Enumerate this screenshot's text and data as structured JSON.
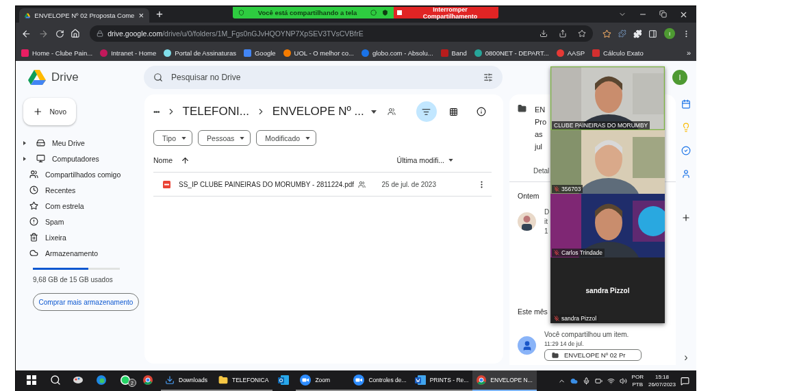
{
  "browser": {
    "tab": {
      "title": "ENVELOPE Nº 02 Proposta Come",
      "close": "×"
    },
    "new_tab": "+",
    "share_banner": {
      "text": "Você está compartilhando a tela",
      "stop": "Interromper Compartilhamento"
    },
    "url": {
      "domain": "drive.google.com",
      "path": "/drive/u/0/folders/1M_Fgs0nGJvHQOYNP7XpSEV3TVsCVBfrE"
    },
    "profile_initial": "I",
    "bookmarks": [
      {
        "label": "Home - Clube Pain...",
        "color": "#e91e63"
      },
      {
        "label": "Intranet - Home",
        "color": "#c2185b"
      },
      {
        "label": "Portal de Assinaturas",
        "color": "#80deea"
      },
      {
        "label": "Google",
        "color": "#4285f4"
      },
      {
        "label": "UOL - O melhor co...",
        "color": "#f57c00"
      },
      {
        "label": "globo.com - Absolu...",
        "color": "#1a73e8"
      },
      {
        "label": "Band",
        "color": "#b71c1c"
      },
      {
        "label": "0800NET - DEPART...",
        "color": "#26a69a"
      },
      {
        "label": "AASP",
        "color": "#e53935"
      },
      {
        "label": "Cálculo Exato",
        "color": "#d32f2f"
      }
    ],
    "bookmarks_more": "»"
  },
  "drive": {
    "logo_text": "Drive",
    "search_placeholder": "Pesquisar no Drive",
    "new_button": "Novo",
    "profile_initial": "I",
    "nav": [
      {
        "label": "Meu Drive",
        "kind": "drive",
        "expandable": true,
        "selected": false
      },
      {
        "label": "Computadores",
        "kind": "computers",
        "expandable": true,
        "selected": false
      },
      {
        "label": "Compartilhados comigo",
        "kind": "shared",
        "expandable": false,
        "selected": false
      },
      {
        "label": "Recentes",
        "kind": "recent",
        "expandable": false,
        "selected": false
      },
      {
        "label": "Com estrela",
        "kind": "starred",
        "expandable": false,
        "selected": false
      },
      {
        "label": "Spam",
        "kind": "spam",
        "expandable": false,
        "selected": false
      },
      {
        "label": "Lixeira",
        "kind": "trash",
        "expandable": false,
        "selected": false
      },
      {
        "label": "Armazenamento",
        "kind": "storage",
        "expandable": false,
        "selected": false
      }
    ],
    "storage": {
      "level": 0.64,
      "text": "9,68 GB de 15 GB usados",
      "button": "Comprar mais armazenamento"
    },
    "breadcrumb": {
      "more": "•••",
      "items": [
        "TELEFONI...",
        "ENVELOPE Nº ..."
      ]
    },
    "filters": [
      "Tipo",
      "Pessoas",
      "Modificado"
    ],
    "filter_panel_open": true,
    "columns": {
      "name": "Nome",
      "modified": "Última modifi..."
    },
    "rows": [
      {
        "name": "SS_IP CLUBE PAINEIRAS DO MORUMBY - 2811224.pdf",
        "shared": true,
        "modified": "25 de jul. de 2023"
      }
    ],
    "details": {
      "title_lines": [
        "EN",
        "Pro",
        "as",
        "jul"
      ],
      "tab": "Detal",
      "sections": [
        {
          "heading": "Ontem",
          "activities": [
            {
              "lines": [
                "D",
                "it",
                "1"
              ]
            }
          ]
        },
        {
          "heading": "Este mês",
          "activities": [
            {
              "kind": "person",
              "text": "Você compartilhou um item.",
              "time": "11:29 14 de jul.",
              "chip": "ENVELOPE Nº 02 Pr"
            }
          ]
        }
      ]
    },
    "side_apps": [
      {
        "kind": "calendar"
      },
      {
        "kind": "keep"
      },
      {
        "kind": "tasks"
      },
      {
        "kind": "contacts"
      },
      {
        "kind": "add"
      }
    ],
    "side_toggle": "›"
  },
  "meeting": {
    "participants": [
      {
        "name": "CLUBE PAINEIRAS DO MORUMBY",
        "video": true,
        "muted": false,
        "speaking": true
      },
      {
        "name": "356703",
        "video": true,
        "muted": true,
        "speaking": false
      },
      {
        "name": "Carlos Trindade",
        "video": true,
        "muted": true,
        "speaking": false
      },
      {
        "name": "sandra Pizzol",
        "center_name": "sandra Pizzol",
        "video": false,
        "muted": true,
        "speaking": false
      }
    ]
  },
  "taskbar": {
    "apps": [
      {
        "kind": "windows"
      },
      {
        "kind": "search"
      },
      {
        "kind": "paint"
      },
      {
        "kind": "edge"
      },
      {
        "kind": "whatsapp",
        "badge": "2"
      },
      {
        "kind": "chrome"
      },
      {
        "kind": "downloads",
        "label": "Downloads",
        "selected": false
      },
      {
        "kind": "folder",
        "label": "TELEFONICA",
        "selected": false
      },
      {
        "kind": "outlook"
      },
      {
        "kind": "zoom",
        "label": "Zoom",
        "selected": false
      },
      {
        "kind": "zoom",
        "label": "Controles de...",
        "selected": false
      },
      {
        "kind": "word",
        "label": "PRINTS - Re...",
        "selected": false
      },
      {
        "kind": "chrome",
        "label": "ENVELOPE N...",
        "selected": true
      }
    ],
    "language": [
      "POR",
      "PTB"
    ],
    "time": "15:18",
    "date": "26/07/2023"
  }
}
